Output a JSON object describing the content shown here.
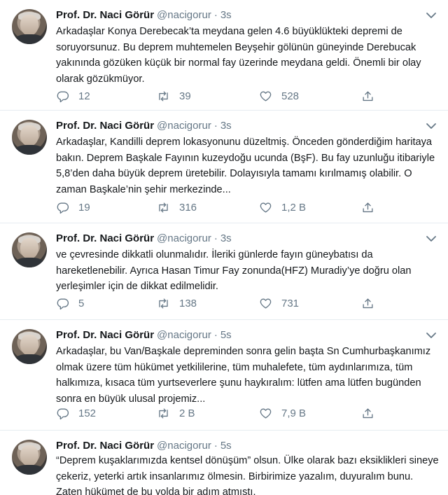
{
  "tweets": [
    {
      "name": "Prof. Dr. Naci Görür",
      "handle": "@nacigorur",
      "time": "3s",
      "text": "Arkadaşlar Konya Derebecak’ta  meydana gelen 4.6 büyüklükteki depremi de soruyorsunuz. Bu deprem muhtemelen Beyşehir gölünün güneyinde Derebucak yakınında gözüken küçük bir normal fay üzerinde meydana geldi. Önemli bir olay olarak gözükmüyor.",
      "replies": "12",
      "retweets": "39",
      "likes": "528"
    },
    {
      "name": "Prof. Dr. Naci Görür",
      "handle": "@nacigorur",
      "time": "3s",
      "text": "Arkadaşlar, Kandilli deprem lokasyonunu düzeltmiş. Önceden gönderdiğim haritaya bakın. Deprem Başkale Fayının kuzeydoğu ucunda (BşF). Bu fay uzunluğu itibariyle 5,8’den daha büyük deprem üretebilir. Dolayısıyla tamamı kırılmamış olabilir. O zaman Başkale’nin şehir merkezinde...",
      "replies": "19",
      "retweets": "316",
      "likes": "1,2 B"
    },
    {
      "name": "Prof. Dr. Naci Görür",
      "handle": "@nacigorur",
      "time": "3s",
      "text": "ve çevresinde dikkatli olunmalıdır. İleriki günlerde fayın güneybatısı da hareketlenebilir. Ayrıca Hasan Timur Fay zonunda(HFZ) Muradiy’ye doğru olan yerleşimler için de dikkat edilmelidir.",
      "replies": "5",
      "retweets": "138",
      "likes": "731"
    },
    {
      "name": "Prof. Dr. Naci Görür",
      "handle": "@nacigorur",
      "time": "5s",
      "text": "Arkadaşlar, bu Van/Başkale depreminden sonra gelin başta Sn Cumhurbaşkanımız olmak üzere tüm hükümet yetkililerine, tüm muhalefete, tüm aydınlarımıza, tüm halkımıza, kısaca tüm yurtseverlere şunu haykıralım: lütfen ama lütfen bugünden sonra en büyük ulusal projemiz...",
      "replies": "152",
      "retweets": "2 B",
      "likes": "7,9 B"
    },
    {
      "name": "Prof. Dr. Naci Görür",
      "handle": "@nacigorur",
      "time": "5s",
      "text": "“Deprem kuşaklarımızda kentsel dönüşüm” olsun. Ülke olarak bazı eksiklikleri sineye çekeriz, yeterki artık insanlarımız ölmesin. Birbirimize yazalım, duyuralım bunu. Zaten hükümet de bu yolda bir adım atmıştı."
    }
  ],
  "icons": {
    "reply": "reply-icon",
    "retweet": "retweet-icon",
    "like": "heart-icon",
    "share": "share-icon",
    "more": "chevron-down-icon"
  },
  "colors": {
    "text": "#14171a",
    "muted": "#657786",
    "divider": "#e6ecf0"
  }
}
